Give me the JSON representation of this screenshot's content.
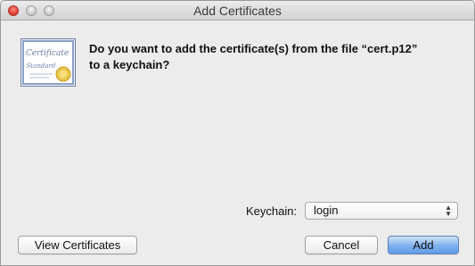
{
  "window": {
    "title": "Add Certificates",
    "controls": [
      "close",
      "minimize",
      "zoom"
    ]
  },
  "dialog": {
    "icon": "certificate-icon",
    "certificate_lettering": [
      "Certificate",
      "Standard"
    ],
    "message_line1": "Do you want to add the certificate(s) from the file “cert.p12”",
    "message_line2": "to a keychain?"
  },
  "keychain": {
    "label": "Keychain:",
    "selected": "login"
  },
  "buttons": {
    "view": "View Certificates",
    "cancel": "Cancel",
    "add": "Add"
  },
  "colors": {
    "default_button": "#7fb0ee",
    "close_button": "#e0443a"
  }
}
